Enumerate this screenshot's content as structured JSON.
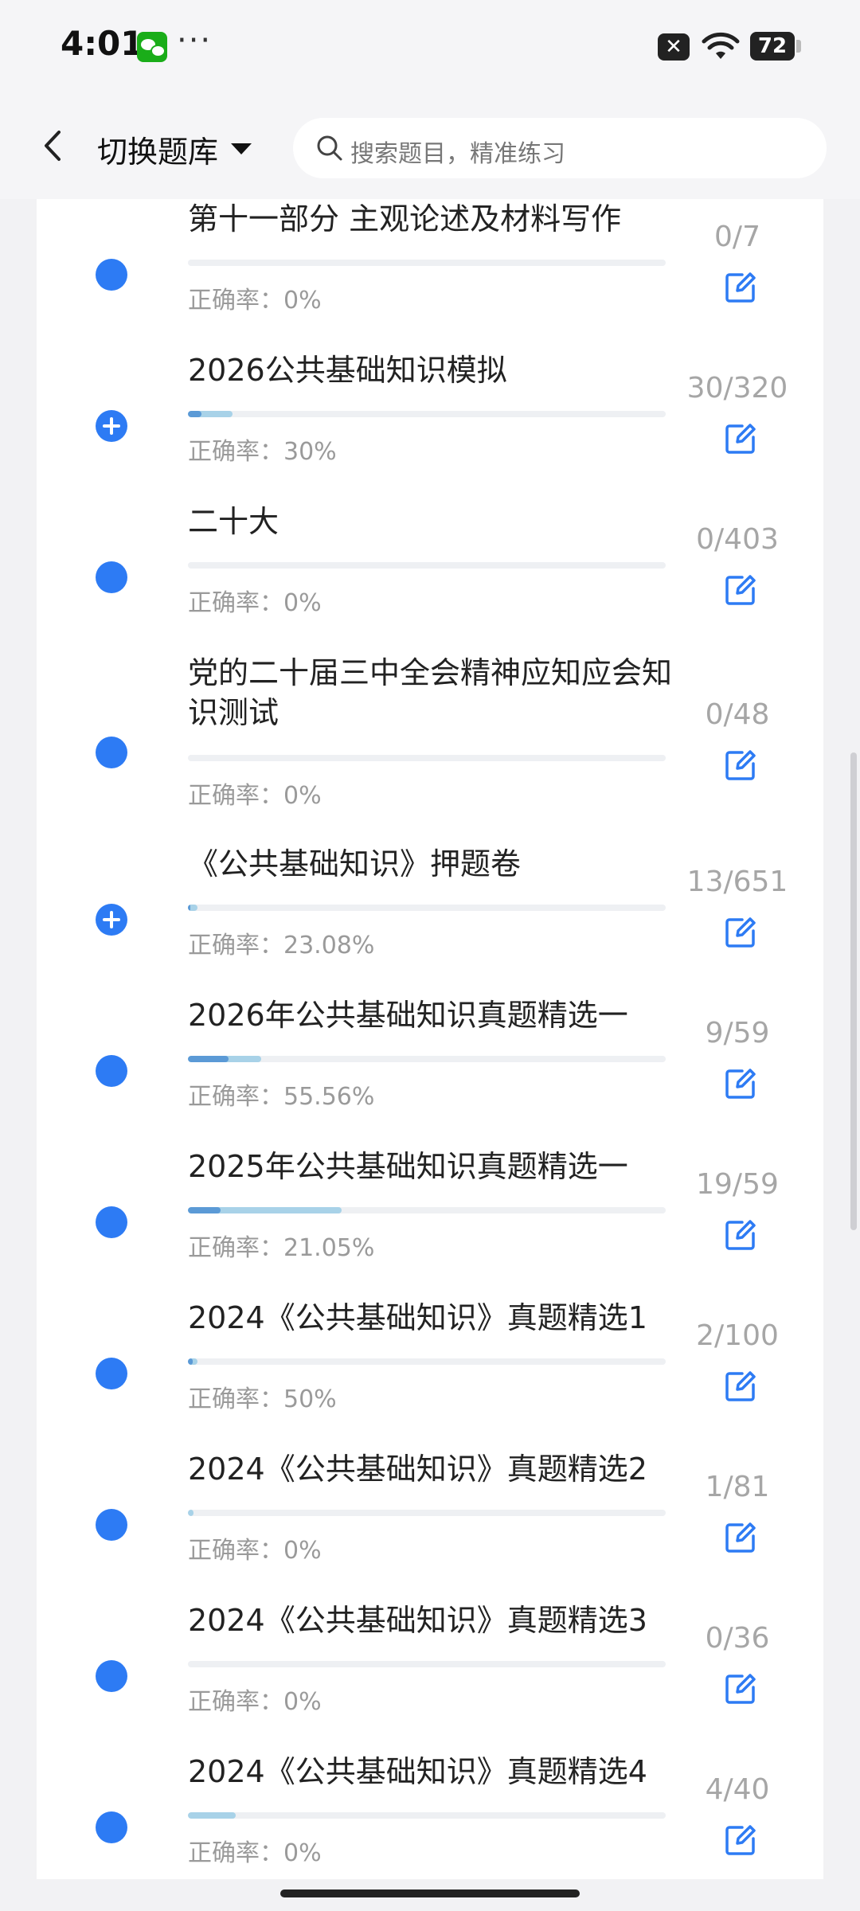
{
  "status_bar": {
    "time": "4:01",
    "dots": "···",
    "battery": "72"
  },
  "header": {
    "title": "切换题库",
    "search_placeholder": "搜索题目，精准练习"
  },
  "rate_prefix": "正确率：",
  "colors": {
    "accent": "#2d7bf4",
    "progress_light": "#a8d2e8",
    "progress_dark": "#5b9ad6"
  },
  "items": [
    {
      "title": "第十一部分 主观论述及材料写作",
      "rate": "正确率：0%",
      "count": "0/7",
      "expandable": false,
      "progress_done": 0,
      "progress_correct": 0
    },
    {
      "title": "2026公共基础知识模拟",
      "rate": "正确率：30%",
      "count": "30/320",
      "expandable": true,
      "progress_done": 0.094,
      "progress_correct": 0.028
    },
    {
      "title": "二十大",
      "rate": "正确率：0%",
      "count": "0/403",
      "expandable": false,
      "progress_done": 0,
      "progress_correct": 0
    },
    {
      "title": "党的二十届三中全会精神应知应会知识测试",
      "rate": "正确率：0%",
      "count": "0/48",
      "expandable": false,
      "progress_done": 0,
      "progress_correct": 0
    },
    {
      "title": "《公共基础知识》押题卷",
      "rate": "正确率：23.08%",
      "count": "13/651",
      "expandable": true,
      "progress_done": 0.02,
      "progress_correct": 0.005
    },
    {
      "title": "2026年公共基础知识真题精选一",
      "rate": "正确率：55.56%",
      "count": "9/59",
      "expandable": false,
      "progress_done": 0.153,
      "progress_correct": 0.085
    },
    {
      "title": "2025年公共基础知识真题精选一",
      "rate": "正确率：21.05%",
      "count": "19/59",
      "expandable": false,
      "progress_done": 0.322,
      "progress_correct": 0.068
    },
    {
      "title": "2024《公共基础知识》真题精选1",
      "rate": "正确率：50%",
      "count": "2/100",
      "expandable": false,
      "progress_done": 0.02,
      "progress_correct": 0.01
    },
    {
      "title": "2024《公共基础知识》真题精选2",
      "rate": "正确率：0%",
      "count": "1/81",
      "expandable": false,
      "progress_done": 0.012,
      "progress_correct": 0
    },
    {
      "title": "2024《公共基础知识》真题精选3",
      "rate": "正确率：0%",
      "count": "0/36",
      "expandable": false,
      "progress_done": 0,
      "progress_correct": 0
    },
    {
      "title": "2024《公共基础知识》真题精选4",
      "rate": "正确率：0%",
      "count": "4/40",
      "expandable": false,
      "progress_done": 0.1,
      "progress_correct": 0
    }
  ]
}
